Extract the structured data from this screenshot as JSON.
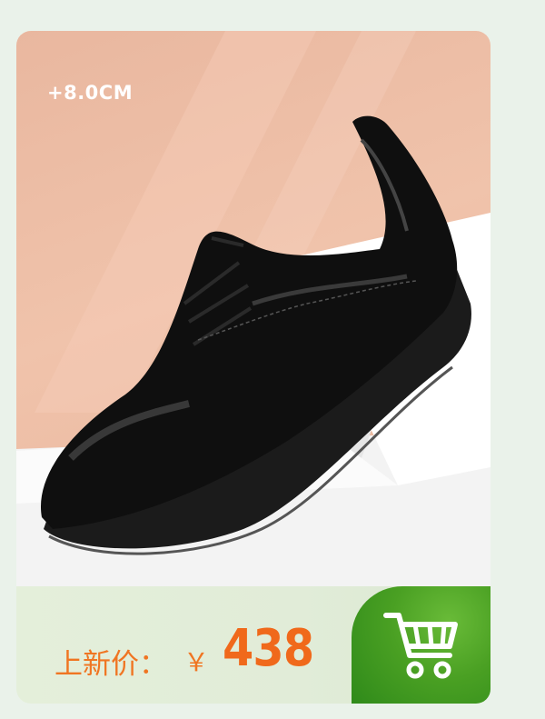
{
  "product": {
    "height_badge": "+8.0CM",
    "image_alt": "black leather lace-up dress shoe on white pedestal"
  },
  "price": {
    "label": "上新价：",
    "currency": "￥",
    "value": "438"
  },
  "cart": {
    "icon": "shopping-cart-icon"
  },
  "colors": {
    "background": "#eaf2ea",
    "accent": "#f07522",
    "cart_green": "#4aa023",
    "photo_bg": "#efbfa7"
  }
}
